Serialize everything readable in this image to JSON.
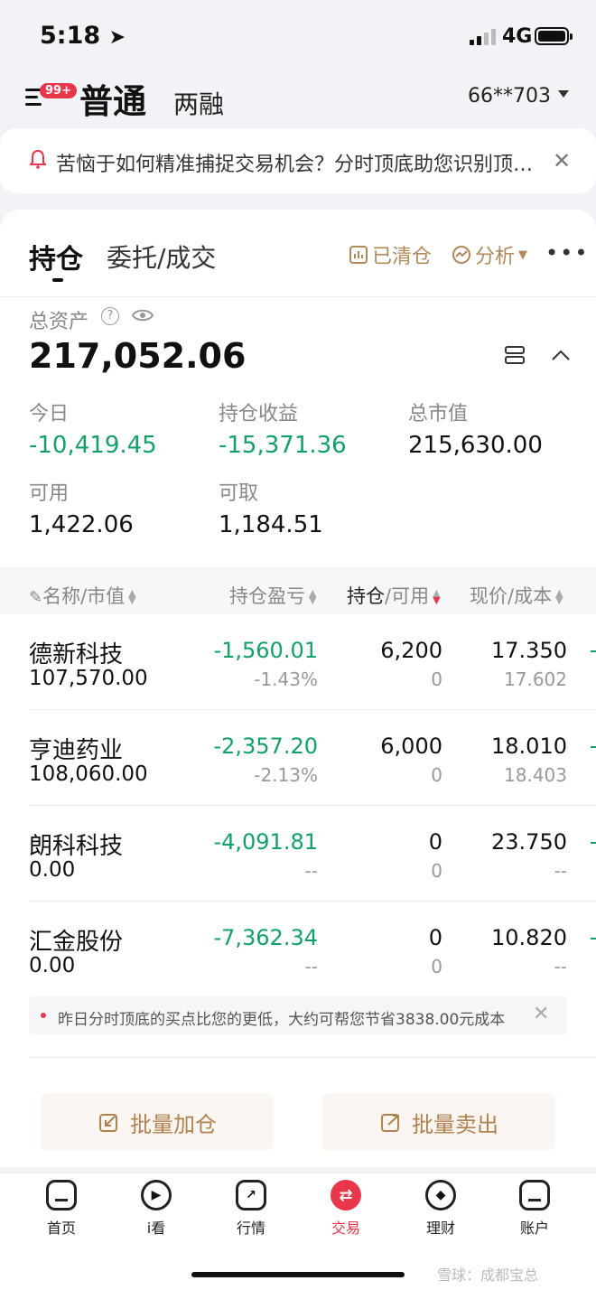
{
  "status_bar": {
    "time": "5:18",
    "network": "4G"
  },
  "header": {
    "badge": "99+",
    "tab_normal": "普通",
    "tab_margin": "两融",
    "account": "66**703"
  },
  "notice": {
    "text": "苦恼于如何精准捕捉交易机会？分时顶底助您识别顶…"
  },
  "tabs": {
    "holdings": "持仓",
    "orders": "委托/成交",
    "cleared": "已清仓",
    "analysis": "分析"
  },
  "summary": {
    "total_label": "总资产",
    "total_value": "217,052.06",
    "stats": [
      {
        "label": "今日",
        "value": "-10,419.45",
        "color": "#13a068"
      },
      {
        "label": "持仓收益",
        "value": "-15,371.36",
        "color": "#13a068"
      },
      {
        "label": "总市值",
        "value": "215,630.00",
        "color": "#111111"
      },
      {
        "label": "可用",
        "value": "1,422.06",
        "color": "#111111"
      },
      {
        "label": "可取",
        "value": "1,184.51",
        "color": "#111111"
      }
    ]
  },
  "table": {
    "headers": [
      "名称/市值",
      "持仓盈亏",
      "持仓",
      "/可用",
      "现价/成本"
    ],
    "rows": [
      {
        "name": "德新科技",
        "market_value": "107,570.00",
        "pnl": "-1,560.01",
        "pnl_pct": "-1.43%",
        "qty": "6,200",
        "avail": "0",
        "price": "17.350",
        "cost": "17.602"
      },
      {
        "name": "亨迪药业",
        "market_value": "108,060.00",
        "pnl": "-2,357.20",
        "pnl_pct": "-2.13%",
        "qty": "6,000",
        "avail": "0",
        "price": "18.010",
        "cost": "18.403"
      },
      {
        "name": "朗科科技",
        "market_value": "0.00",
        "pnl": "-4,091.81",
        "pnl_pct": "--",
        "qty": "0",
        "avail": "0",
        "price": "23.750",
        "cost": "--"
      },
      {
        "name": "汇金股份",
        "market_value": "0.00",
        "pnl": "-7,362.34",
        "pnl_pct": "--",
        "qty": "0",
        "avail": "0",
        "price": "10.820",
        "cost": "--"
      }
    ]
  },
  "tip": {
    "text": "昨日分时顶底的买点比您的更低，大约可帮您节省3838.00元成本"
  },
  "actions": {
    "bulk_add": "批量加仓",
    "bulk_sell": "批量卖出"
  },
  "tabbar": [
    {
      "label": "首页",
      "icon": "home-icon"
    },
    {
      "label": "i看",
      "icon": "play-icon"
    },
    {
      "label": "行情",
      "icon": "chart-icon"
    },
    {
      "label": "交易",
      "icon": "trade-icon",
      "active": true
    },
    {
      "label": "理财",
      "icon": "finance-icon"
    },
    {
      "label": "账户",
      "icon": "account-icon"
    }
  ],
  "watermark": "雪球：成都宝总"
}
